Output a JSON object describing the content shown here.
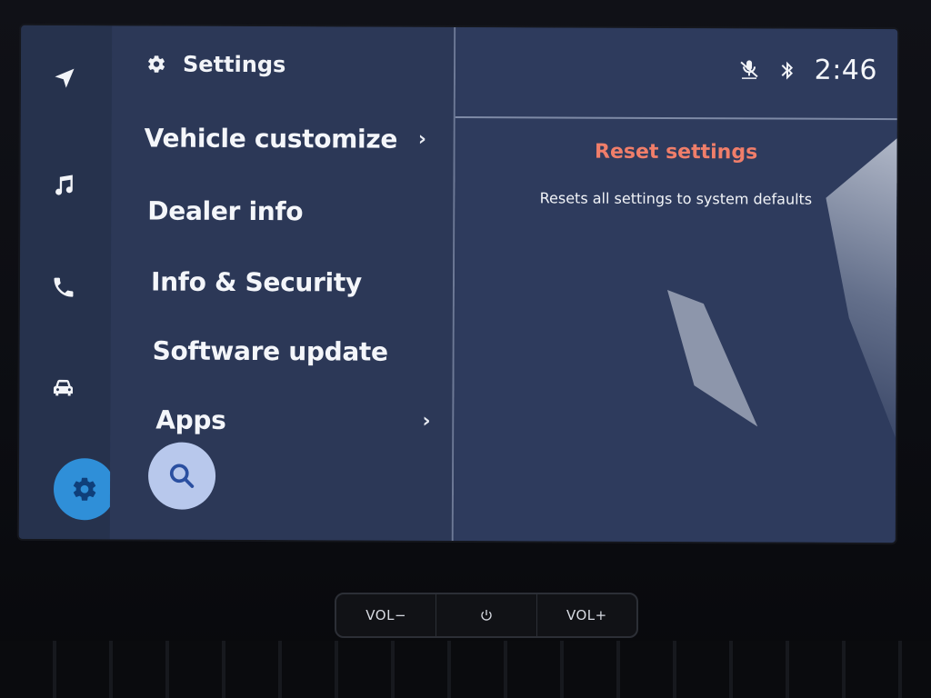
{
  "rail": {
    "items": [
      {
        "name": "navigation",
        "icon": "navigation-arrow-icon"
      },
      {
        "name": "music",
        "icon": "music-note-icon"
      },
      {
        "name": "phone",
        "icon": "phone-icon"
      },
      {
        "name": "vehicle",
        "icon": "car-icon"
      },
      {
        "name": "settings",
        "icon": "gear-icon",
        "active": true
      }
    ]
  },
  "list_panel": {
    "title": "Settings",
    "header_icon": "gear-icon",
    "items": [
      {
        "label": "Vehicle customize",
        "has_chevron": true
      },
      {
        "label": "Dealer info",
        "has_chevron": false
      },
      {
        "label": "Info & Security",
        "has_chevron": false
      },
      {
        "label": "Software update",
        "has_chevron": false
      },
      {
        "label": "Apps",
        "has_chevron": true
      }
    ],
    "chevron": "›",
    "search_icon": "search-icon"
  },
  "status_bar": {
    "icons": [
      "voice-muted-icon",
      "bluetooth-icon"
    ],
    "time": "2:46"
  },
  "detail": {
    "title": "Reset settings",
    "description": "Resets all settings to system defaults",
    "title_color": "#f07e6a"
  },
  "hardware_buttons": {
    "vol_down": "VOL−",
    "power_icon": "power-icon",
    "vol_up": "VOL+"
  },
  "colors": {
    "accent": "#2f8fd8",
    "panel_bg": "#2c3857"
  }
}
